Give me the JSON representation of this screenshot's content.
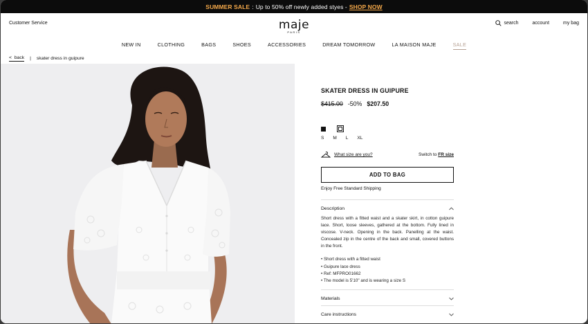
{
  "promo": {
    "prefix": "SUMMER SALE",
    "sep": ":",
    "message": "Up to 50% off newly added styes -",
    "cta": "SHOP NOW"
  },
  "header": {
    "customer_service": "Customer Service",
    "logo": "maje",
    "logo_sub": "PARIS",
    "search": "search",
    "account": "account",
    "bag": "my bag"
  },
  "nav": [
    "NEW IN",
    "CLOTHING",
    "BAGS",
    "SHOES",
    "ACCESSORIES",
    "DREAM TOMORROW",
    "LA MAISON MAJE",
    "SALE"
  ],
  "breadcrumb": {
    "back": "back",
    "divider": "|",
    "current": "skater dress in guipure"
  },
  "product": {
    "title": "SKATER DRESS IN GUIPURE",
    "old_price": "$415.00",
    "discount": "-50%",
    "price": "$207.50",
    "sizes": [
      "S",
      "M",
      "L",
      "XL"
    ],
    "size_help": "What size are you?",
    "switch_prefix": "Switch to",
    "switch_size": "FR size",
    "add_to_bag": "ADD TO BAG",
    "shipping": "Enjoy Free Standard Shipping"
  },
  "accordion": {
    "description_label": "Description",
    "description_text": "Short dress with a fitted waist and a skater skirt, in cotton guipure lace. Short, loose sleeves, gathered at the bottom. Fully lined in viscose. V-neck. Opening in the back. Panelling at the waist. Concealed zip in the centre of the back and small, covered buttons in the front.",
    "bullets": [
      "• Short dress with a fitted waist",
      "• Guipure lace dress",
      "• Ref: MFPRO01662",
      "• The model is 5'10\" and is wearing a size S"
    ],
    "materials_label": "Materials",
    "care_label": "Care instructions"
  },
  "colors": {
    "accent": "#f5a94a",
    "sale": "#b5a092",
    "swatch_dark": "#111111",
    "swatch_light": "#ffffff"
  }
}
